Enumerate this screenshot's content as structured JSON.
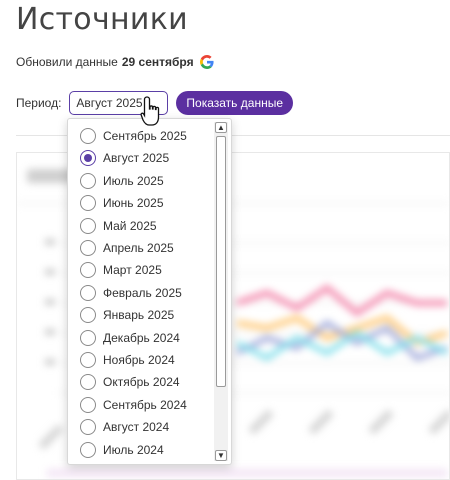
{
  "page": {
    "title": "Источники"
  },
  "updated": {
    "prefix": "Обновили данные",
    "date": "29 сентября"
  },
  "period": {
    "label": "Период:",
    "selected": "Август 2025",
    "show_button": "Показать данные"
  },
  "dropdown": {
    "options": [
      {
        "label": "Сентябрь 2025",
        "checked": false
      },
      {
        "label": "Август 2025",
        "checked": true
      },
      {
        "label": "Июль 2025",
        "checked": false
      },
      {
        "label": "Июнь 2025",
        "checked": false
      },
      {
        "label": "Май 2025",
        "checked": false
      },
      {
        "label": "Апрель 2025",
        "checked": false
      },
      {
        "label": "Март 2025",
        "checked": false
      },
      {
        "label": "Февраль 2025",
        "checked": false
      },
      {
        "label": "Январь 2025",
        "checked": false
      },
      {
        "label": "Декабрь 2024",
        "checked": false
      },
      {
        "label": "Ноябрь 2024",
        "checked": false
      },
      {
        "label": "Октябрь 2024",
        "checked": false
      },
      {
        "label": "Сентябрь 2024",
        "checked": false
      },
      {
        "label": "Август 2024",
        "checked": false
      },
      {
        "label": "Июль 2024",
        "checked": false
      }
    ]
  },
  "colors": {
    "accent": "#5b3fa6",
    "button_bg": "#5b2fa0"
  },
  "icons": {
    "google": "google-icon",
    "cursor": "hand-pointer-icon",
    "scroll_up": "chevron-up-icon",
    "scroll_down": "chevron-down-icon"
  }
}
